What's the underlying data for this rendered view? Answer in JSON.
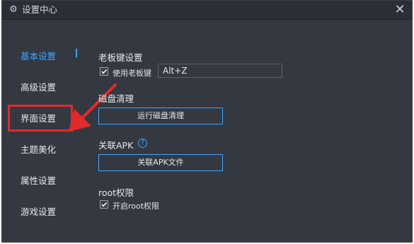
{
  "window": {
    "title": "设置中心",
    "title_icon": "gear-icon",
    "close_icon": "close-icon"
  },
  "sidebar": {
    "items": [
      {
        "label": "基本设置",
        "active": true
      },
      {
        "label": "高级设置",
        "active": false
      },
      {
        "label": "界面设置",
        "active": false,
        "highlighted": true
      },
      {
        "label": "主题美化",
        "active": false
      },
      {
        "label": "属性设置",
        "active": false
      },
      {
        "label": "游戏设置",
        "active": false
      }
    ]
  },
  "boss_key": {
    "title": "老板键设置",
    "checkbox_label": "使用老板键",
    "checked": true,
    "hotkey_value": "Alt+Z"
  },
  "disk_clean": {
    "title": "磁盘清理",
    "button_label": "运行磁盘清理"
  },
  "apk": {
    "title": "关联APK",
    "help_icon": "help-icon",
    "button_label": "关联APK文件"
  },
  "root": {
    "title": "root权限",
    "checkbox_label": "开启root权限",
    "checked": true
  },
  "colors": {
    "accent": "#3fa3ff",
    "highlight": "#e22a2a",
    "background": "#343941",
    "titlebar": "#2a2e36"
  }
}
